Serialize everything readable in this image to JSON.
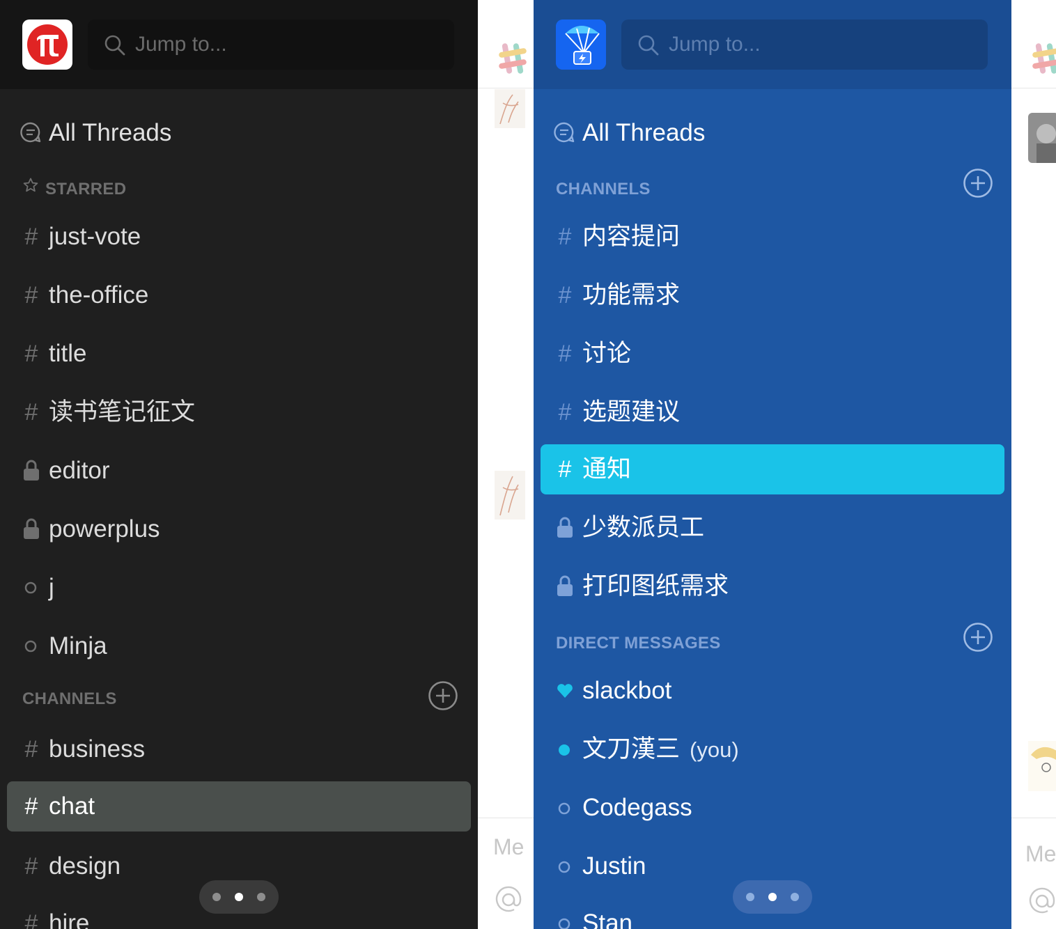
{
  "left": {
    "team_logo": "pi-logo",
    "search": {
      "placeholder": "Jump to..."
    },
    "all_threads": "All Threads",
    "starred_header": "STARRED",
    "starred": [
      {
        "icon": "#",
        "label": "just-vote"
      },
      {
        "icon": "#",
        "label": "the-office"
      },
      {
        "icon": "#",
        "label": "title"
      },
      {
        "icon": "#",
        "label": "读书笔记征文"
      },
      {
        "icon": "lock",
        "label": "editor"
      },
      {
        "icon": "lock",
        "label": "powerplus"
      },
      {
        "icon": "presence-away",
        "label": "j"
      },
      {
        "icon": "presence-away",
        "label": "Minja"
      }
    ],
    "channels_header": "CHANNELS",
    "channels": [
      {
        "icon": "#",
        "label": "business",
        "selected": false
      },
      {
        "icon": "#",
        "label": "chat",
        "selected": true
      },
      {
        "icon": "#",
        "label": "design",
        "selected": false
      },
      {
        "icon": "#",
        "label": "hire",
        "selected": false
      }
    ],
    "pager": {
      "count": 3,
      "active": 1
    }
  },
  "right": {
    "team_logo": "parachute-logo",
    "search": {
      "placeholder": "Jump to..."
    },
    "all_threads": "All Threads",
    "channels_header": "CHANNELS",
    "channels": [
      {
        "icon": "#",
        "label": "内容提问",
        "selected": false
      },
      {
        "icon": "#",
        "label": "功能需求",
        "selected": false
      },
      {
        "icon": "#",
        "label": "讨论",
        "selected": false
      },
      {
        "icon": "#",
        "label": "选题建议",
        "selected": false
      },
      {
        "icon": "#",
        "label": "通知",
        "selected": true
      },
      {
        "icon": "lock",
        "label": "少数派员工",
        "selected": false
      },
      {
        "icon": "lock",
        "label": "打印图纸需求",
        "selected": false
      }
    ],
    "dm_header": "DIRECT MESSAGES",
    "dms": [
      {
        "icon": "heart",
        "label": "slackbot",
        "suffix": ""
      },
      {
        "icon": "presence-active",
        "label": "文刀漢三",
        "suffix": "(you)"
      },
      {
        "icon": "presence-away",
        "label": "Codegass",
        "suffix": ""
      },
      {
        "icon": "presence-away",
        "label": "Justin",
        "suffix": ""
      },
      {
        "icon": "presence-away",
        "label": "Stan",
        "suffix": ""
      }
    ],
    "pager": {
      "count": 3,
      "active": 1
    }
  },
  "background": {
    "message_placeholder_fragment": "Me",
    "mention_icon": "at-icon",
    "app_icon": "slack-logo"
  },
  "colors": {
    "left_sidebar": "#1f1f1f",
    "left_selected": "#4a4f4c",
    "right_sidebar": "#1e57a3",
    "right_selected": "#1ac3e8",
    "presence_active": "#1ac3e8",
    "team_pi_red": "#e02424"
  }
}
